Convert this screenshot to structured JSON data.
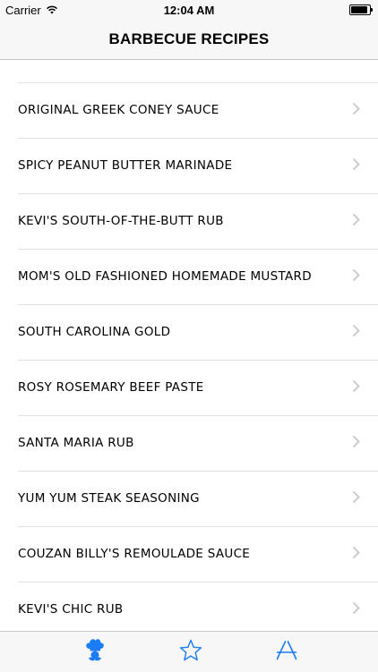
{
  "status_bar": {
    "carrier": "Carrier",
    "time": "12:04 AM",
    "battery_level": 1.0
  },
  "nav": {
    "title": "BARBECUE RECIPES"
  },
  "recipes": [
    {
      "label": ""
    },
    {
      "label": "ORIGINAL GREEK CONEY SAUCE"
    },
    {
      "label": "SPICY PEANUT BUTTER MARINADE"
    },
    {
      "label": "KEVI'S SOUTH-OF-THE-BUTT RUB"
    },
    {
      "label": "MOM'S OLD FASHIONED HOMEMADE MUSTARD"
    },
    {
      "label": "SOUTH CAROLINA GOLD"
    },
    {
      "label": "ROSY ROSEMARY BEEF PASTE"
    },
    {
      "label": "SANTA MARIA RUB"
    },
    {
      "label": "YUM YUM STEAK SEASONING"
    },
    {
      "label": "COUZAN BILLY'S REMOULADE SAUCE"
    },
    {
      "label": "KEVI'S CHIC RUB"
    },
    {
      "label": ""
    }
  ],
  "tab_bar": {
    "tabs": [
      {
        "icon": "chef-icon",
        "selected": true
      },
      {
        "icon": "star-icon",
        "selected": false
      },
      {
        "icon": "app-store-icon",
        "selected": false
      }
    ]
  },
  "colors": {
    "accent": "#1b7cf5",
    "separator": "#e0e0e5",
    "chevron": "#c7c7cc",
    "bar_background": "#f7f7f7"
  }
}
